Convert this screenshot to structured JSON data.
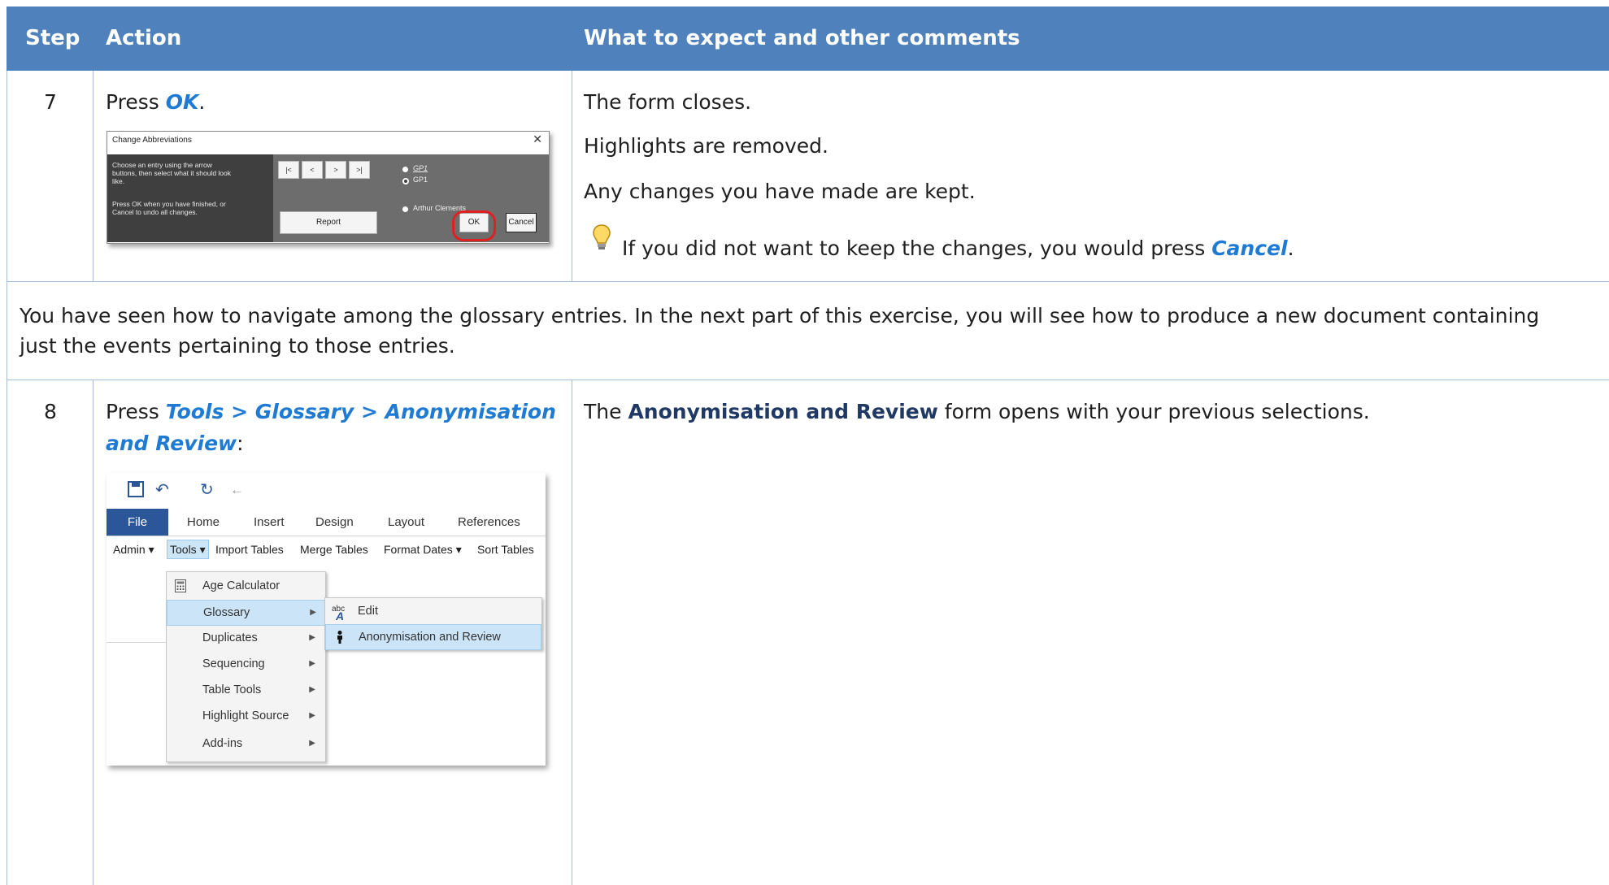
{
  "header": {
    "step": "Step",
    "action": "Action",
    "expect": "What to expect and other comments"
  },
  "row7": {
    "step": "7",
    "action_prefix": "Press ",
    "action_link": "OK",
    "action_suffix": ".",
    "expect_lines": [
      "The form closes.",
      "Highlights are removed.",
      "Any changes you have made are kept."
    ],
    "tip_prefix": "If you did not want to keep the changes, you would press ",
    "tip_link": "Cancel",
    "tip_suffix": "."
  },
  "dialog": {
    "title": "Change Abbreviations",
    "close": "✕",
    "help1": "Choose an entry using the arrow\nbuttons, then select what it should look\nlike.",
    "help2": "Press OK when you have finished, or\nCancel to undo all changes.",
    "nav": [
      "|<",
      "<",
      ">",
      ">|"
    ],
    "options": [
      "GP1",
      "GP1",
      "Arthur Clements"
    ],
    "report": "Report",
    "ok": "OK",
    "cancel": "Cancel"
  },
  "note": {
    "line1": "You have seen how to navigate among the glossary entries. In the next part of this exercise, you will see how to produce a new document containing",
    "line2": "just the events pertaining to those entries."
  },
  "row8": {
    "step": "8",
    "action_prefix": "Press ",
    "action_link1": "Tools > Glossary > Anonymisation",
    "action_link2": "and Review",
    "action_suffix": ":",
    "expect_prefix": "The ",
    "expect_bold": "Anonymisation and Review",
    "expect_suffix": " form opens with your previous selections."
  },
  "word": {
    "tabs": [
      "File",
      "Home",
      "Insert",
      "Design",
      "Layout",
      "References"
    ],
    "toolbar": [
      "Admin ▾",
      "Tools ▾",
      "Import Tables",
      "Merge Tables",
      "Format Dates ▾",
      "Sort Tables"
    ],
    "menu": [
      "Age Calculator",
      "Glossary",
      "Duplicates",
      "Sequencing",
      "Table Tools",
      "Highlight Source",
      "Add-ins"
    ],
    "submenu": [
      "Edit",
      "Anonymisation and Review"
    ]
  },
  "colors": {
    "header": "#4f81bd",
    "link": "#1f7ad3",
    "grid": "#a3bfd9"
  }
}
